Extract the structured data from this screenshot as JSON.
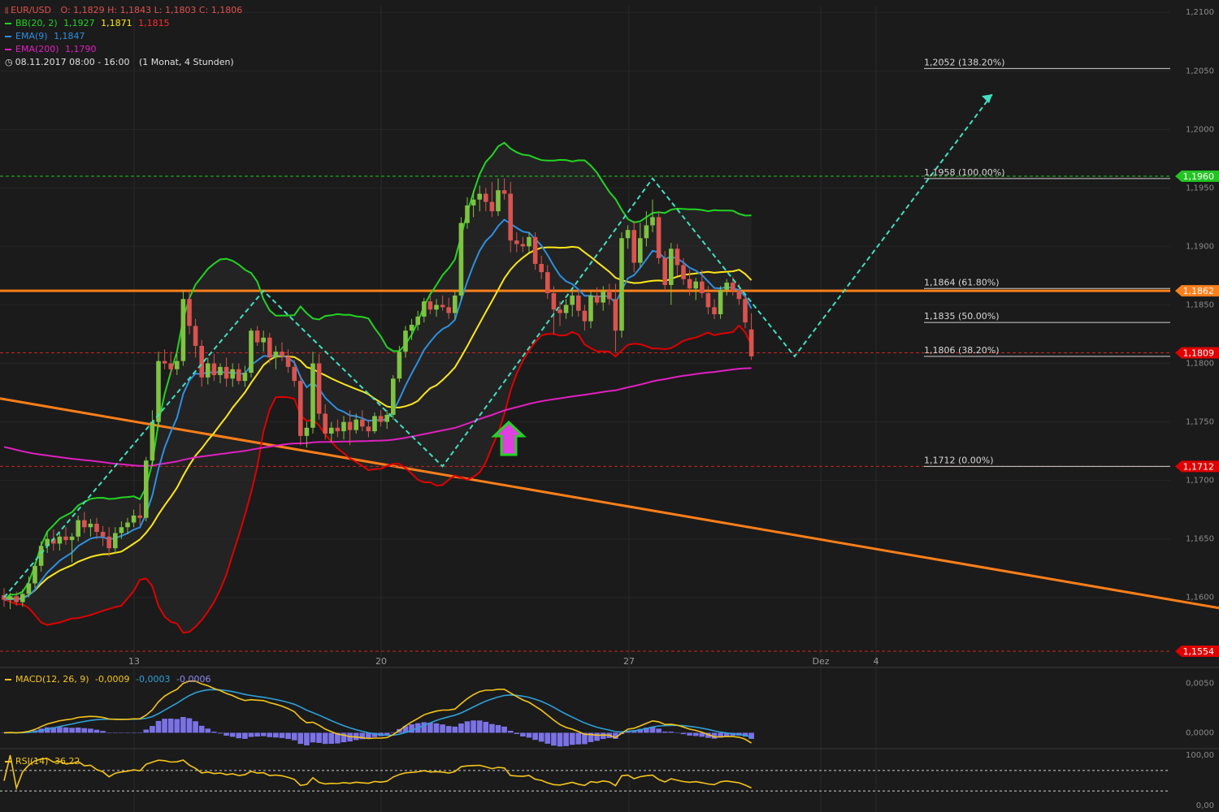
{
  "header": {
    "symbol": "EUR/USD",
    "ohlc": "O: 1,1829  H: 1,1843  L: 1,1803  C: 1,1806",
    "bb_label": "BB(20, 2)",
    "bb_v1": "1,1927",
    "bb_v2": "1,1871",
    "bb_v3": "1,1815",
    "ema9_label": "EMA(9)",
    "ema9_v": "1,1847",
    "ema200_label": "EMA(200)",
    "ema200_v": "1,1790",
    "period": "08.11.2017 08:00 - 16:00",
    "interval": "(1 Monat, 4 Stunden)"
  },
  "colors": {
    "bg": "#1b1b1b",
    "up": "#7fc342",
    "down": "#d9534f",
    "bb_upper": "#22d422",
    "bb_mid": "#ffe81a",
    "bb_lower": "#e00000",
    "ema9": "#2e8fe0",
    "ema200": "#e020c0",
    "trend": "#ff7f1a",
    "zigzag": "#40e0c0",
    "macd": "#f5c518",
    "signal": "#2ea0d8",
    "hist": "#7b72e6",
    "rsi": "#f5c518"
  },
  "chart_data": {
    "type": "candlestick",
    "price_axis": {
      "ticks": [
        "1,2100",
        "1,2050",
        "1,2000",
        "1,1950",
        "1,1900",
        "1,1850",
        "1,1800",
        "1,1750",
        "1,1700",
        "1,1650",
        "1,1600"
      ],
      "ylim": [
        1.1545,
        1.2105
      ]
    },
    "x_ticks": [
      "13",
      "20",
      "27",
      "Dez",
      "4"
    ],
    "fibonacci": [
      {
        "label": "1,2052 (138.20%)",
        "price": 1.2052
      },
      {
        "label": "1,1958 (100.00%)",
        "price": 1.1958
      },
      {
        "label": "1,1864 (61.80%)",
        "price": 1.1864
      },
      {
        "label": "1,1835 (50.00%)",
        "price": 1.1835
      },
      {
        "label": "1,1806 (38.20%)",
        "price": 1.1806
      },
      {
        "label": "1,1712 (0.00%)",
        "price": 1.1712
      }
    ],
    "price_tags": [
      {
        "label": "1,1960",
        "price": 1.196,
        "color": "#22c422"
      },
      {
        "label": "1,1862",
        "price": 1.1862,
        "color": "#ff7f1a"
      },
      {
        "label": "1,1809",
        "price": 1.1809,
        "color": "#e00000"
      },
      {
        "label": "1,1712",
        "price": 1.1712,
        "color": "#e00000"
      },
      {
        "label": "1,1554",
        "price": 1.1554,
        "color": "#e00000"
      }
    ],
    "candles": [
      [
        1.1602,
        1.1608,
        1.1592,
        1.1598
      ],
      [
        1.1598,
        1.1604,
        1.159,
        1.1601
      ],
      [
        1.1601,
        1.1605,
        1.1593,
        1.1596
      ],
      [
        1.1596,
        1.1607,
        1.1592,
        1.1603
      ],
      [
        1.1603,
        1.1618,
        1.16,
        1.1612
      ],
      [
        1.1612,
        1.163,
        1.1608,
        1.1627
      ],
      [
        1.1627,
        1.1648,
        1.1622,
        1.1644
      ],
      [
        1.1644,
        1.1656,
        1.1638,
        1.165
      ],
      [
        1.165,
        1.1658,
        1.164,
        1.1646
      ],
      [
        1.1646,
        1.1655,
        1.164,
        1.1652
      ],
      [
        1.1652,
        1.166,
        1.1645,
        1.1649
      ],
      [
        1.1649,
        1.1655,
        1.163,
        1.1652
      ],
      [
        1.1652,
        1.167,
        1.1648,
        1.1666
      ],
      [
        1.1666,
        1.1673,
        1.1655,
        1.166
      ],
      [
        1.166,
        1.1667,
        1.1652,
        1.1663
      ],
      [
        1.1663,
        1.1668,
        1.165,
        1.1656
      ],
      [
        1.1656,
        1.1661,
        1.1644,
        1.1652
      ],
      [
        1.1652,
        1.166,
        1.1635,
        1.1642
      ],
      [
        1.1642,
        1.166,
        1.1638,
        1.1655
      ],
      [
        1.1655,
        1.1665,
        1.165,
        1.166
      ],
      [
        1.166,
        1.1668,
        1.1654,
        1.1664
      ],
      [
        1.1664,
        1.1675,
        1.166,
        1.167
      ],
      [
        1.167,
        1.168,
        1.1662,
        1.1668
      ],
      [
        1.1668,
        1.172,
        1.1665,
        1.1717
      ],
      [
        1.1717,
        1.176,
        1.1712,
        1.175
      ],
      [
        1.175,
        1.181,
        1.1745,
        1.1802
      ],
      [
        1.1802,
        1.1812,
        1.1795,
        1.18
      ],
      [
        1.18,
        1.181,
        1.179,
        1.1795
      ],
      [
        1.1795,
        1.1808,
        1.179,
        1.1802
      ],
      [
        1.1802,
        1.1862,
        1.1798,
        1.1855
      ],
      [
        1.1855,
        1.1862,
        1.1825,
        1.1832
      ],
      [
        1.1832,
        1.1838,
        1.1805,
        1.1815
      ],
      [
        1.1815,
        1.182,
        1.178,
        1.1788
      ],
      [
        1.1788,
        1.1805,
        1.1782,
        1.18
      ],
      [
        1.18,
        1.1808,
        1.1785,
        1.179
      ],
      [
        1.179,
        1.18,
        1.1783,
        1.1797
      ],
      [
        1.1797,
        1.1805,
        1.178,
        1.1787
      ],
      [
        1.1787,
        1.18,
        1.178,
        1.1795
      ],
      [
        1.1795,
        1.18,
        1.1782,
        1.1785
      ],
      [
        1.1785,
        1.1798,
        1.178,
        1.1792
      ],
      [
        1.1792,
        1.183,
        1.1788,
        1.1828
      ],
      [
        1.1828,
        1.1832,
        1.1815,
        1.1818
      ],
      [
        1.1818,
        1.1828,
        1.181,
        1.1822
      ],
      [
        1.1822,
        1.1826,
        1.18,
        1.1805
      ],
      [
        1.1805,
        1.1815,
        1.1795,
        1.181
      ],
      [
        1.181,
        1.1818,
        1.1802,
        1.1806
      ],
      [
        1.1806,
        1.1812,
        1.1792,
        1.1797
      ],
      [
        1.1797,
        1.1803,
        1.178,
        1.1785
      ],
      [
        1.1785,
        1.179,
        1.173,
        1.1738
      ],
      [
        1.1738,
        1.175,
        1.1728,
        1.1745
      ],
      [
        1.1745,
        1.181,
        1.174,
        1.18
      ],
      [
        1.18,
        1.1808,
        1.1752,
        1.1757
      ],
      [
        1.1757,
        1.1765,
        1.1735,
        1.174
      ],
      [
        1.174,
        1.175,
        1.1733,
        1.1745
      ],
      [
        1.1745,
        1.1752,
        1.1737,
        1.1742
      ],
      [
        1.1742,
        1.1755,
        1.1735,
        1.175
      ],
      [
        1.175,
        1.176,
        1.173,
        1.1743
      ],
      [
        1.1743,
        1.1757,
        1.174,
        1.1752
      ],
      [
        1.1752,
        1.176,
        1.1742,
        1.1746
      ],
      [
        1.1746,
        1.1752,
        1.1737,
        1.1742
      ],
      [
        1.1742,
        1.1758,
        1.174,
        1.1755
      ],
      [
        1.1755,
        1.176,
        1.1746,
        1.175
      ],
      [
        1.175,
        1.176,
        1.1744,
        1.1756
      ],
      [
        1.1756,
        1.179,
        1.1752,
        1.1787
      ],
      [
        1.1787,
        1.1815,
        1.1784,
        1.181
      ],
      [
        1.181,
        1.1832,
        1.1805,
        1.1828
      ],
      [
        1.1828,
        1.1838,
        1.182,
        1.1833
      ],
      [
        1.1833,
        1.1845,
        1.1828,
        1.184
      ],
      [
        1.184,
        1.1856,
        1.1835,
        1.1853
      ],
      [
        1.1853,
        1.1858,
        1.1842,
        1.1846
      ],
      [
        1.1846,
        1.1855,
        1.184,
        1.185
      ],
      [
        1.185,
        1.1858,
        1.1845,
        1.1848
      ],
      [
        1.1848,
        1.1856,
        1.1838,
        1.1843
      ],
      [
        1.1843,
        1.1862,
        1.1838,
        1.1858
      ],
      [
        1.1858,
        1.1925,
        1.1854,
        1.192
      ],
      [
        1.192,
        1.1942,
        1.1915,
        1.1935
      ],
      [
        1.1935,
        1.1948,
        1.1925,
        1.194
      ],
      [
        1.194,
        1.1952,
        1.193,
        1.1945
      ],
      [
        1.1945,
        1.195,
        1.193,
        1.1938
      ],
      [
        1.1938,
        1.1955,
        1.1925,
        1.193
      ],
      [
        1.193,
        1.1958,
        1.1926,
        1.1948
      ],
      [
        1.1948,
        1.1958,
        1.194,
        1.1945
      ],
      [
        1.1945,
        1.1955,
        1.1895,
        1.1905
      ],
      [
        1.1905,
        1.1912,
        1.1895,
        1.1902
      ],
      [
        1.1902,
        1.1908,
        1.1895,
        1.19
      ],
      [
        1.19,
        1.1912,
        1.1895,
        1.1908
      ],
      [
        1.1908,
        1.1912,
        1.188,
        1.1885
      ],
      [
        1.1885,
        1.1892,
        1.1872,
        1.1878
      ],
      [
        1.1878,
        1.1884,
        1.1855,
        1.186
      ],
      [
        1.186,
        1.1866,
        1.1825,
        1.1846
      ],
      [
        1.1846,
        1.1853,
        1.1832,
        1.1843
      ],
      [
        1.1843,
        1.1855,
        1.1838,
        1.185
      ],
      [
        1.185,
        1.1862,
        1.184,
        1.1858
      ],
      [
        1.1858,
        1.1862,
        1.184,
        1.1845
      ],
      [
        1.1845,
        1.185,
        1.1828,
        1.1836
      ],
      [
        1.1836,
        1.1862,
        1.183,
        1.1858
      ],
      [
        1.1858,
        1.1865,
        1.185,
        1.1852
      ],
      [
        1.1852,
        1.1866,
        1.1845,
        1.1862
      ],
      [
        1.1862,
        1.1868,
        1.185,
        1.1855
      ],
      [
        1.1855,
        1.1868,
        1.181,
        1.1828
      ],
      [
        1.1828,
        1.1912,
        1.1822,
        1.1907
      ],
      [
        1.1907,
        1.1918,
        1.1898,
        1.1914
      ],
      [
        1.1914,
        1.1922,
        1.1878,
        1.1886
      ],
      [
        1.1886,
        1.192,
        1.1882,
        1.1907
      ],
      [
        1.1907,
        1.193,
        1.19,
        1.1918
      ],
      [
        1.1918,
        1.194,
        1.1912,
        1.1925
      ],
      [
        1.1925,
        1.193,
        1.1885,
        1.189
      ],
      [
        1.189,
        1.1896,
        1.1862,
        1.1867
      ],
      [
        1.1867,
        1.1903,
        1.185,
        1.1898
      ],
      [
        1.1898,
        1.1902,
        1.1875,
        1.1884
      ],
      [
        1.1884,
        1.189,
        1.1867,
        1.1872
      ],
      [
        1.1872,
        1.188,
        1.1858,
        1.1864
      ],
      [
        1.1864,
        1.1873,
        1.1854,
        1.187
      ],
      [
        1.187,
        1.188,
        1.1856,
        1.186
      ],
      [
        1.186,
        1.1866,
        1.1842,
        1.1848
      ],
      [
        1.1848,
        1.1855,
        1.1838,
        1.1842
      ],
      [
        1.1842,
        1.1866,
        1.1838,
        1.1863
      ],
      [
        1.1863,
        1.1872,
        1.1858,
        1.1869
      ],
      [
        1.1869,
        1.1874,
        1.1858,
        1.1862
      ],
      [
        1.1862,
        1.1868,
        1.185,
        1.1855
      ],
      [
        1.1855,
        1.186,
        1.183,
        1.1835
      ],
      [
        1.1829,
        1.1843,
        1.1803,
        1.1806
      ]
    ],
    "macd": {
      "label": "MACD(12, 26, 9)",
      "values_text": [
        "-0,0009",
        "-0,0003",
        "-0,0006"
      ],
      "ticks": [
        "0,0050",
        "0,0000"
      ],
      "range": [
        -0.0012,
        0.0058
      ]
    },
    "rsi": {
      "label": "RSI(14)",
      "value_text": "36,22",
      "ticks": [
        "100,00",
        "0,00"
      ],
      "range": [
        0,
        100
      ],
      "levels": [
        70,
        30
      ]
    }
  }
}
